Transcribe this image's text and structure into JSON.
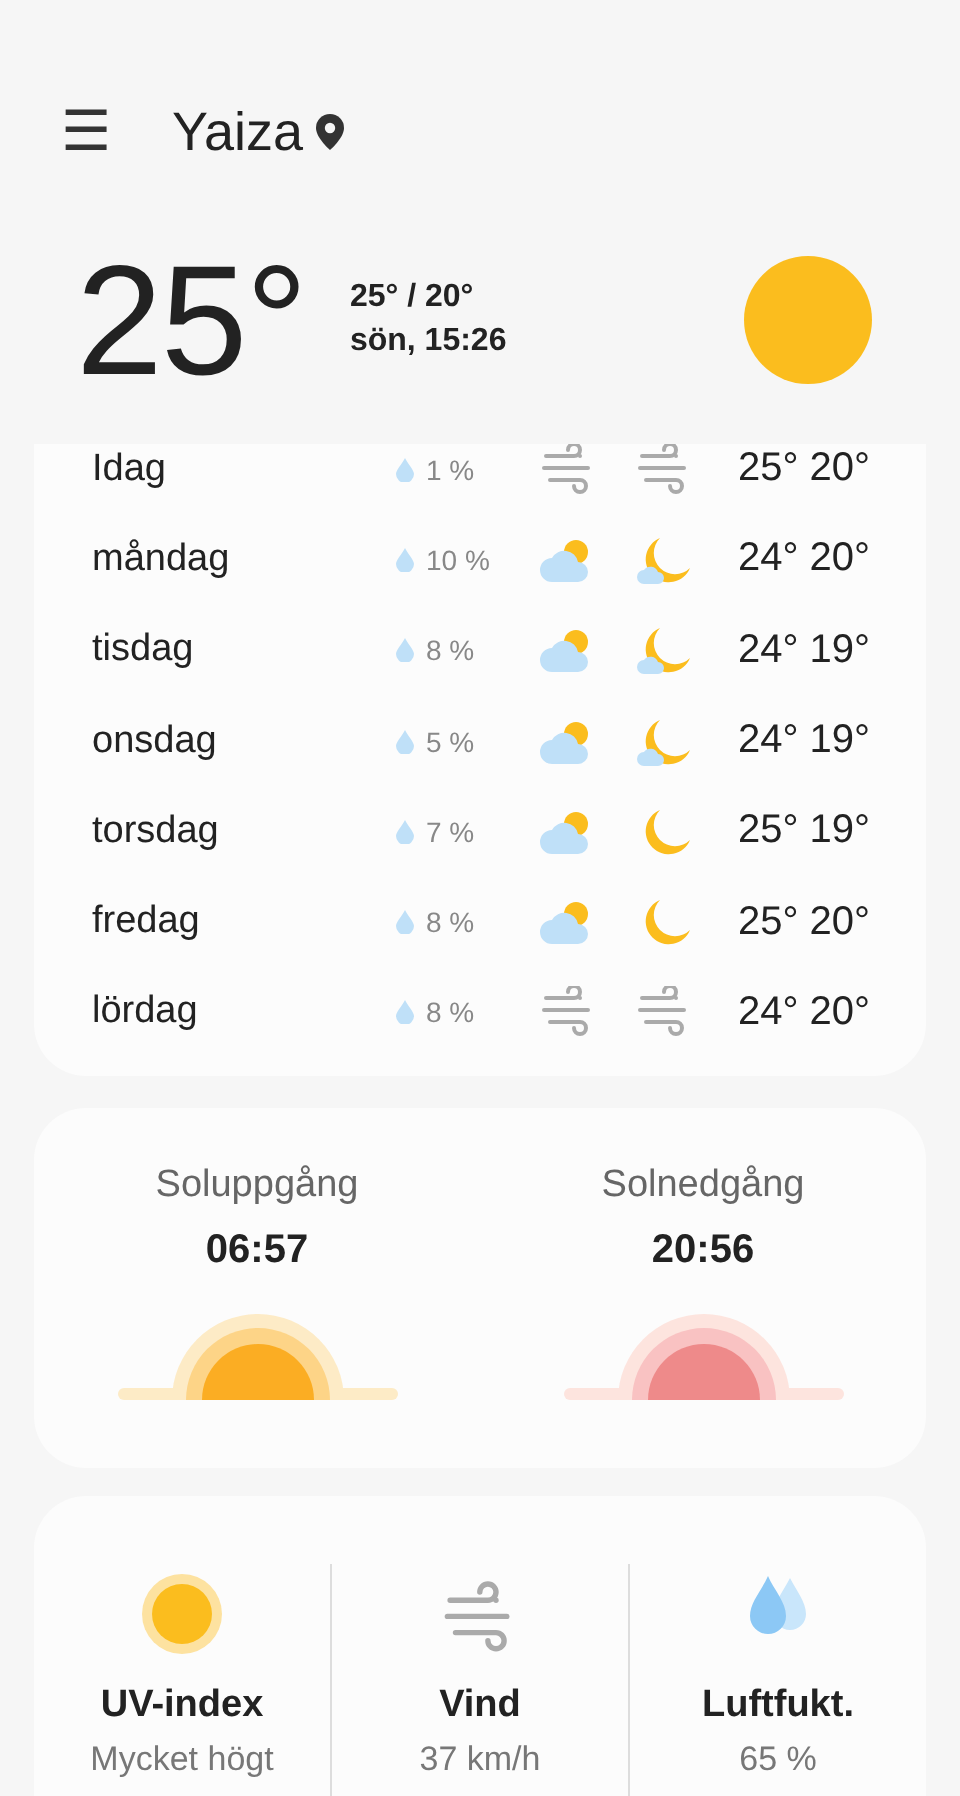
{
  "header": {
    "menu_icon": "☰",
    "location": "Yaiza"
  },
  "current": {
    "temperature": "25°",
    "high_low": "25° / 20°",
    "date_time": "sön, 15:26",
    "weather_icon": {
      "kind": "sun"
    }
  },
  "forecast": [
    {
      "day": "Idag",
      "precipitation": "1 %",
      "icons": [
        {
          "kind": "wind"
        },
        {
          "kind": "wind"
        }
      ],
      "temps": "25° 20°"
    },
    {
      "day": "måndag",
      "precipitation": "10 %",
      "icons": [
        {
          "kind": "partly-cloudy"
        },
        {
          "kind": "moon-cloud"
        }
      ],
      "temps": "24° 20°"
    },
    {
      "day": "tisdag",
      "precipitation": "8 %",
      "icons": [
        {
          "kind": "partly-cloudy"
        },
        {
          "kind": "moon-cloud"
        }
      ],
      "temps": "24° 19°"
    },
    {
      "day": "onsdag",
      "precipitation": "5 %",
      "icons": [
        {
          "kind": "partly-cloudy"
        },
        {
          "kind": "moon-cloud"
        }
      ],
      "temps": "24° 19°"
    },
    {
      "day": "torsdag",
      "precipitation": "7 %",
      "icons": [
        {
          "kind": "partly-cloudy"
        },
        {
          "kind": "moon"
        }
      ],
      "temps": "25° 19°"
    },
    {
      "day": "fredag",
      "precipitation": "8 %",
      "icons": [
        {
          "kind": "partly-cloudy"
        },
        {
          "kind": "moon"
        }
      ],
      "temps": "25° 20°"
    },
    {
      "day": "lördag",
      "precipitation": "8 %",
      "icons": [
        {
          "kind": "wind"
        },
        {
          "kind": "wind"
        }
      ],
      "temps": "24° 20°"
    }
  ],
  "sun": [
    {
      "kind": "sunrise",
      "label": "Soluppgång",
      "time": "06:57"
    },
    {
      "kind": "sunset",
      "label": "Solnedgång",
      "time": "20:56"
    }
  ],
  "details": [
    {
      "kind": "uv",
      "label": "UV-index",
      "value": "Mycket högt"
    },
    {
      "kind": "wind",
      "label": "Vind",
      "value": "37 km/h"
    },
    {
      "kind": "humidity",
      "label": "Luftfukt.",
      "value": "65 %"
    }
  ]
}
